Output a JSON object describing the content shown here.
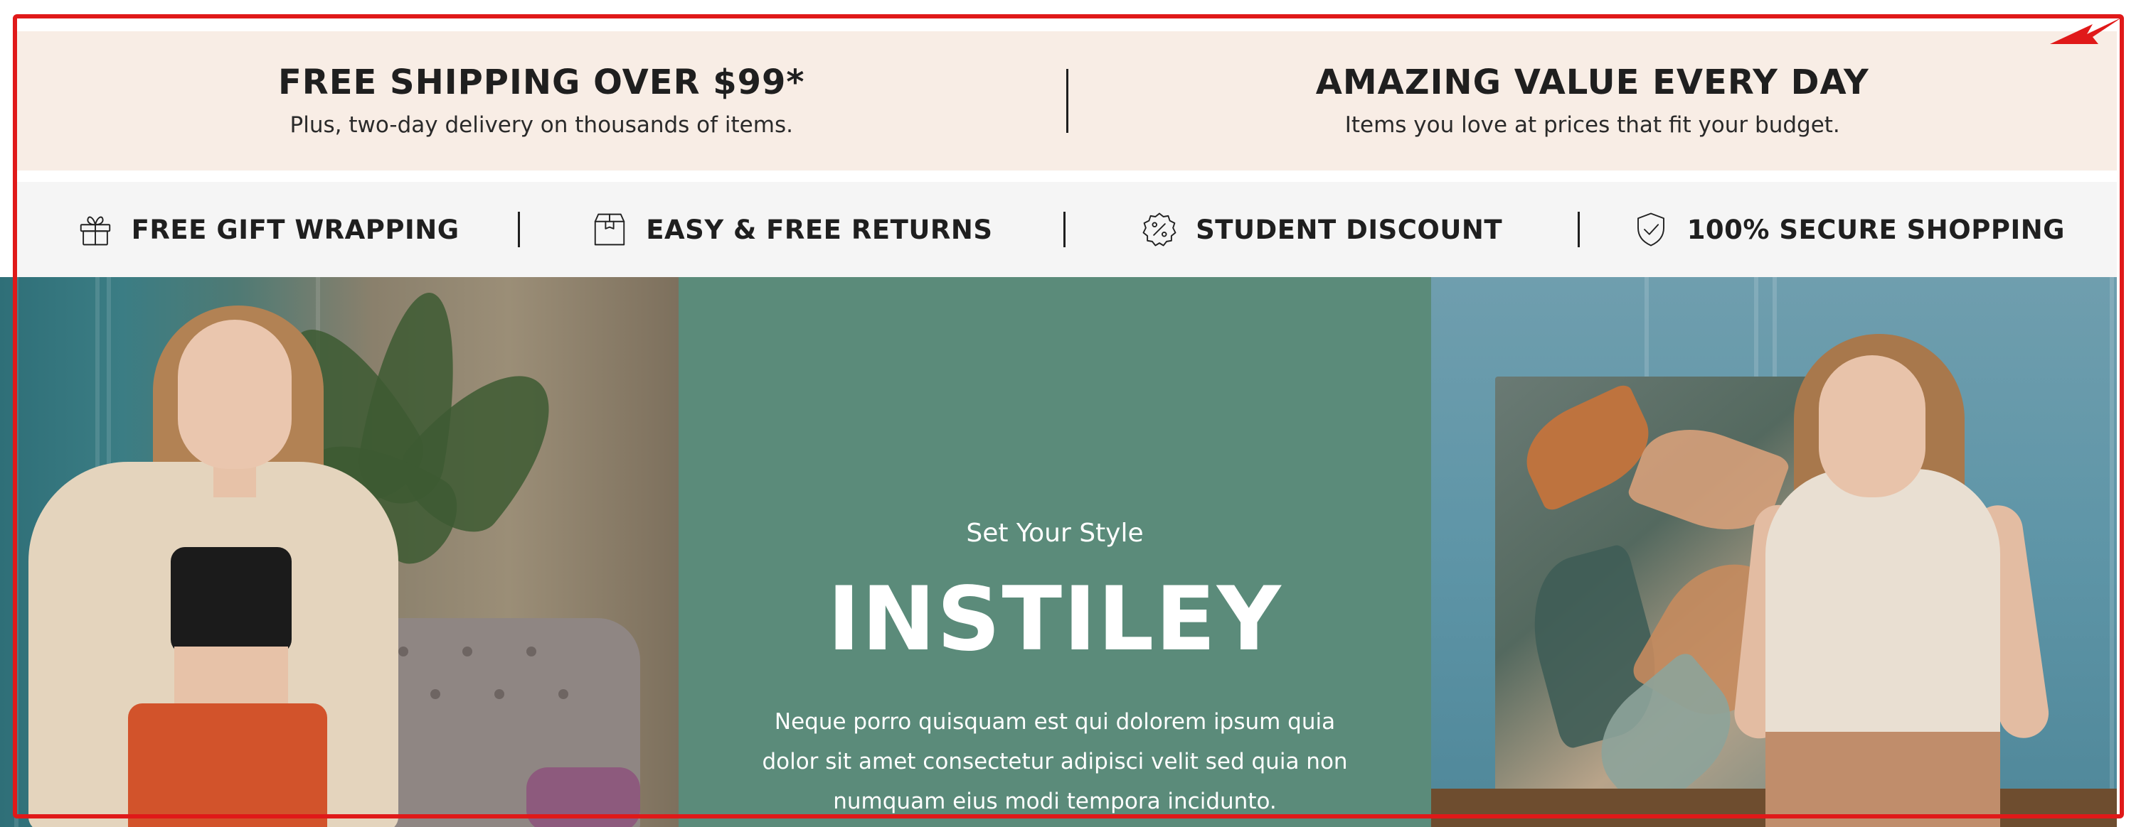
{
  "promo_band": {
    "left": {
      "title": "FREE SHIPPING OVER $99*",
      "subtitle": "Plus, two-day delivery on thousands of items."
    },
    "right": {
      "title": "AMAZING VALUE EVERY DAY",
      "subtitle": "Items you love at prices that fit your budget."
    }
  },
  "features": [
    {
      "label": "FREE GIFT WRAPPING",
      "icon": "gift-icon"
    },
    {
      "label": "EASY & FREE RETURNS",
      "icon": "box-icon"
    },
    {
      "label": "STUDENT DISCOUNT",
      "icon": "percent-badge-icon"
    },
    {
      "label": "100% SECURE SHOPPING",
      "icon": "shield-check-icon"
    }
  ],
  "hero": {
    "kicker": "Set Your Style",
    "title": "INSTILEY",
    "text": "Neque porro quisquam est qui dolorem ipsum quia dolor sit amet consectetur adipisci velit sed quia non numquam eius modi tempora incidunto."
  },
  "colors": {
    "promo_bg": "#f8ede5",
    "feature_bg": "#f5f5f5",
    "hero_center_bg": "#5b8b7a",
    "annotation": "#e01919",
    "text_dark": "#1f1f1f"
  }
}
